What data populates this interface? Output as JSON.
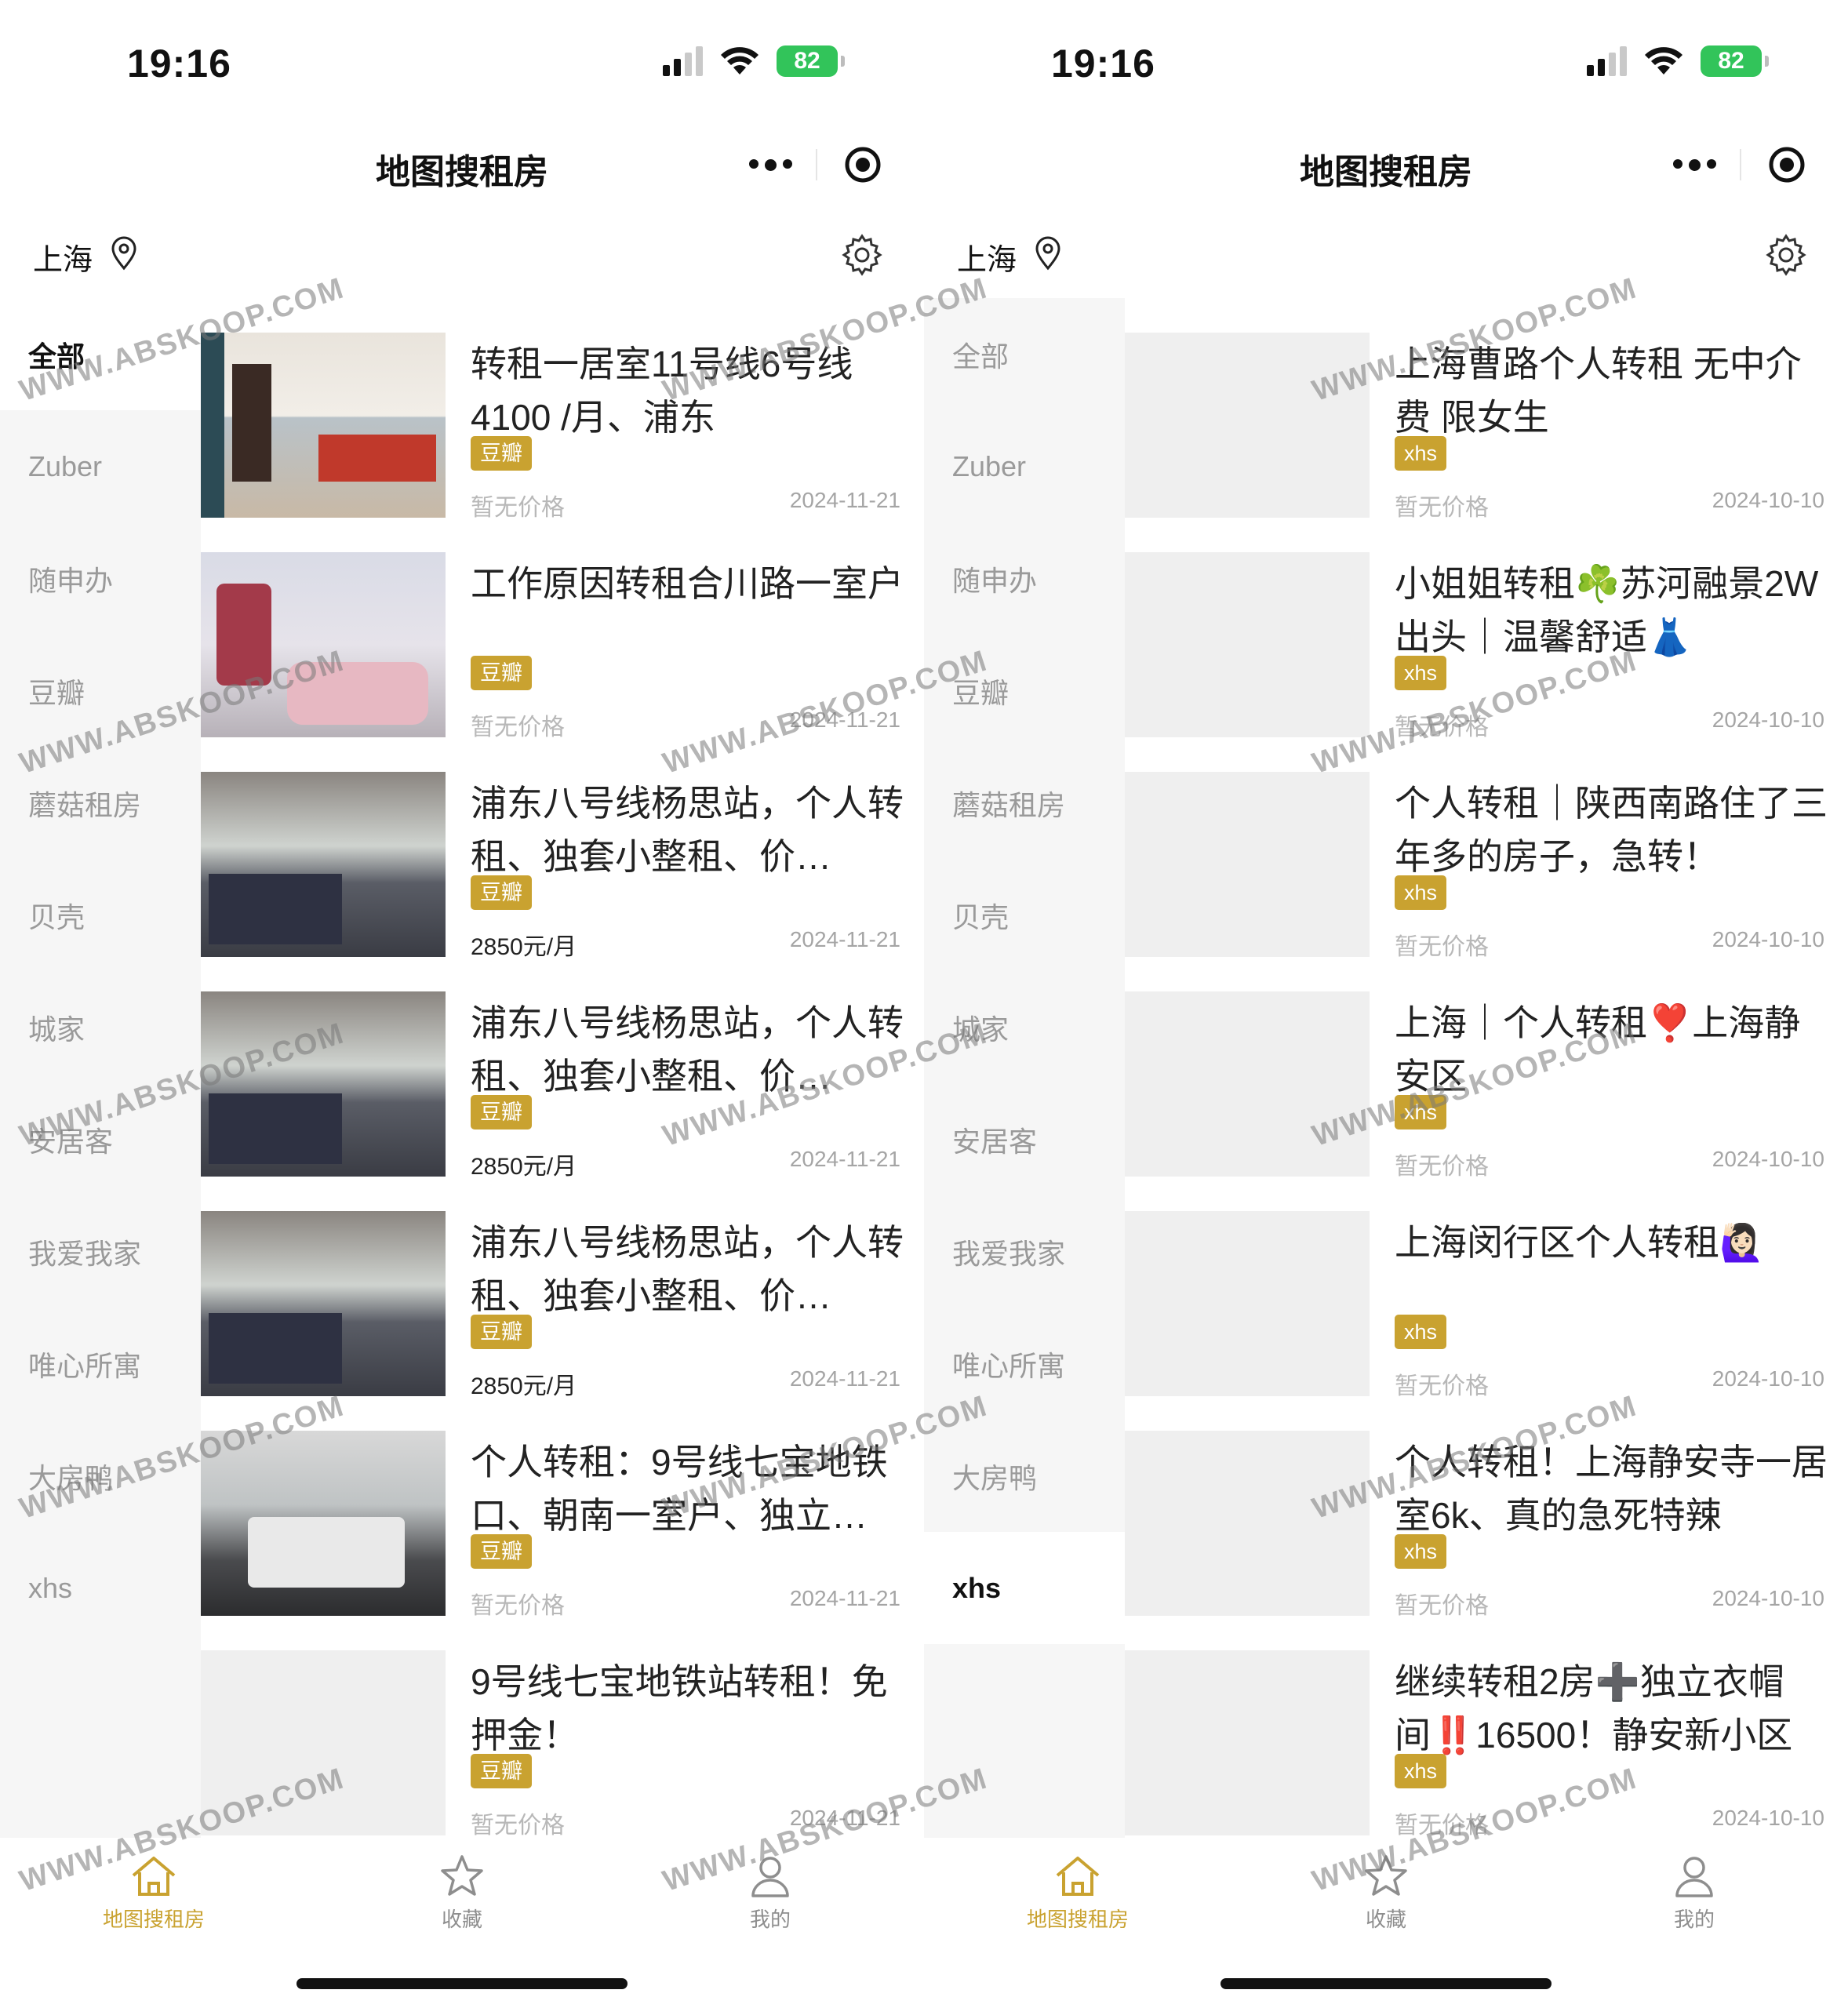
{
  "status": {
    "time": "19:16",
    "battery": "82"
  },
  "nav": {
    "title": "地图搜租房"
  },
  "city": {
    "name": "上海"
  },
  "sidebar": {
    "items": [
      "全部",
      "Zuber",
      "随申办",
      "豆瓣",
      "蘑菇租房",
      "贝壳",
      "城家",
      "安居客",
      "我爱我家",
      "唯心所寓",
      "大房鸭",
      "xhs"
    ]
  },
  "left": {
    "active_category": "全部",
    "listings": [
      {
        "title": "转租一居室11号线6号线4100 /月、浦东",
        "tag": "豆瓣",
        "price": "暂无价格",
        "date": "2024-11-21"
      },
      {
        "title": "工作原因转租合川路一室户",
        "tag": "豆瓣",
        "price": "暂无价格",
        "date": "2024-11-21"
      },
      {
        "title": "浦东八号线杨思站，个人转租、独套小整租、价…",
        "tag": "豆瓣",
        "price": "2850元/月",
        "date": "2024-11-21"
      },
      {
        "title": "浦东八号线杨思站，个人转租、独套小整租、价…",
        "tag": "豆瓣",
        "price": "2850元/月",
        "date": "2024-11-21"
      },
      {
        "title": "浦东八号线杨思站，个人转租、独套小整租、价…",
        "tag": "豆瓣",
        "price": "2850元/月",
        "date": "2024-11-21"
      },
      {
        "title": "个人转租：9号线七宝地铁口、朝南一室户、独立…",
        "tag": "豆瓣",
        "price": "暂无价格",
        "date": "2024-11-21"
      },
      {
        "title": "9号线七宝地铁站转租！免押金！",
        "tag": "豆瓣",
        "price": "暂无价格",
        "date": "2024-11-21"
      }
    ]
  },
  "right": {
    "active_category": "xhs",
    "listings": [
      {
        "title": "上海曹路个人转租 无中介费 限女生",
        "tag": "xhs",
        "price": "暂无价格",
        "date": "2024-10-10"
      },
      {
        "title": "小姐姐转租☘️苏河融景2W出头｜温馨舒适👗",
        "tag": "xhs",
        "price": "暂无价格",
        "date": "2024-10-10"
      },
      {
        "title": "个人转租｜陕西南路住了三年多的房子，急转！",
        "tag": "xhs",
        "price": "暂无价格",
        "date": "2024-10-10"
      },
      {
        "title": "上海｜个人转租❣️上海静安区",
        "tag": "xhs",
        "price": "暂无价格",
        "date": "2024-10-10"
      },
      {
        "title": "上海闵行区个人转租🙋🏻‍♀️",
        "tag": "xhs",
        "price": "暂无价格",
        "date": "2024-10-10"
      },
      {
        "title": "个人转租！上海静安寺一居室6k、真的急死特辣",
        "tag": "xhs",
        "price": "暂无价格",
        "date": "2024-10-10"
      },
      {
        "title": "继续转租2房➕独立衣帽间‼️16500！静安新小区",
        "tag": "xhs",
        "price": "暂无价格",
        "date": "2024-10-10"
      }
    ]
  },
  "tabs": [
    {
      "label": "地图搜租房",
      "icon": "home-icon"
    },
    {
      "label": "收藏",
      "icon": "star-icon"
    },
    {
      "label": "我的",
      "icon": "user-icon"
    }
  ],
  "watermark": "WWW.ABSKOOP.COM",
  "colors": {
    "accent": "#c9a230",
    "sidebar_bg": "#f6f6f6",
    "battery": "#32c45a"
  }
}
